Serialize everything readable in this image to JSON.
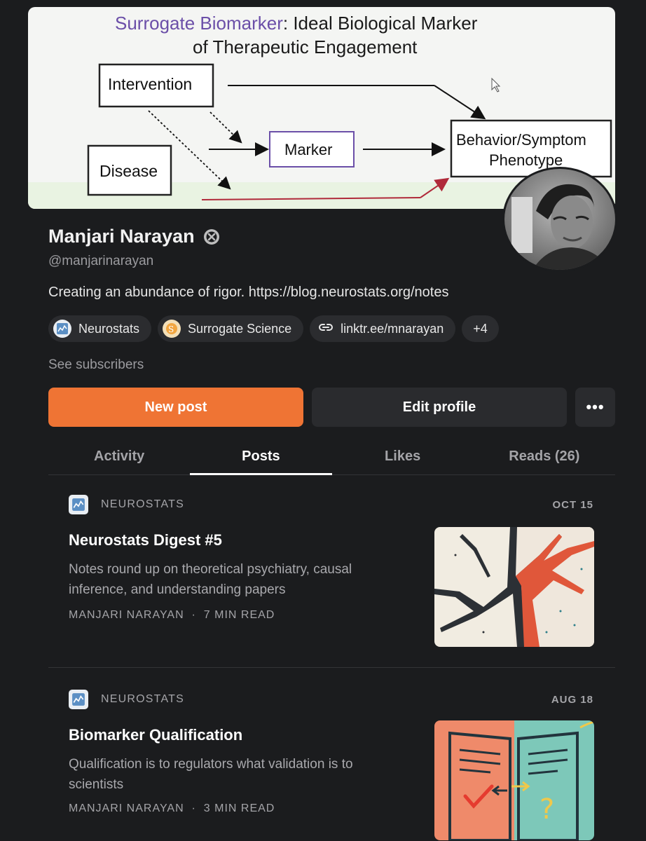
{
  "banner": {
    "title_highlight": "Surrogate Biomarker",
    "title_rest": ": Ideal Biological Marker",
    "title_line2": "of Therapeutic Engagement",
    "box_intervention": "Intervention",
    "box_disease": "Disease",
    "box_marker": "Marker",
    "box_behavior_line1": "Behavior/Symptom",
    "box_behavior_line2": "Phenotype"
  },
  "profile": {
    "name": "Manjari Narayan",
    "handle": "@manjarinarayan",
    "bio": "Creating an abundance of rigor. https://blog.neurostats.org/notes",
    "see_subscribers": "See subscribers"
  },
  "chips": [
    {
      "label": "Neurostats",
      "icon": "neurostats-logo-icon"
    },
    {
      "label": "Surrogate Science",
      "icon": "surrogate-science-logo-icon"
    },
    {
      "label": "linktr.ee/mnarayan",
      "icon": "link-icon"
    },
    {
      "label": "+4"
    }
  ],
  "actions": {
    "new_post": "New post",
    "edit_profile": "Edit profile",
    "more": "•••"
  },
  "tabs": [
    {
      "label": "Activity",
      "active": false
    },
    {
      "label": "Posts",
      "active": true
    },
    {
      "label": "Likes",
      "active": false
    },
    {
      "label": "Reads (26)",
      "active": false
    }
  ],
  "posts": [
    {
      "publication": "NEUROSTATS",
      "date": "OCT 15",
      "title": "Neurostats Digest #5",
      "subtitle": "Notes round up on theoretical psychiatry, causal inference, and understanding papers",
      "author": "MANJARI NARAYAN",
      "read_time": "7 MIN READ"
    },
    {
      "publication": "NEUROSTATS",
      "date": "AUG 18",
      "title": "Biomarker Qualification",
      "subtitle": "Qualification is to regulators what validation is to scientists",
      "author": "MANJARI NARAYAN",
      "read_time": "3 MIN READ"
    }
  ],
  "colors": {
    "accent": "#ef7434",
    "background": "#1b1c1e",
    "muted_text": "#a4a4a8"
  }
}
